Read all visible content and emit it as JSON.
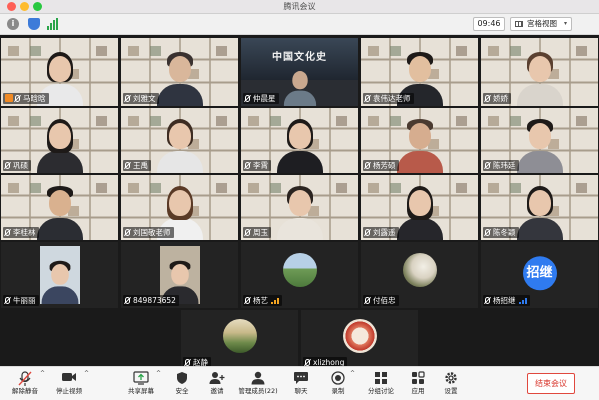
{
  "window": {
    "title": "腾讯会议"
  },
  "topbar": {
    "info_icon": "info-icon",
    "timer": "09:46",
    "view_label": "宫格视图"
  },
  "colors": {
    "active_speaker": "#2fd14b",
    "end_meeting": "#d8342a",
    "avatar_blue": "#2f7bf0"
  },
  "participants": [
    {
      "name": "马晗晗",
      "host": true,
      "muted": true
    },
    {
      "name": "刘雅文",
      "muted": true,
      "active": true
    },
    {
      "name": "仲晨星",
      "muted": true,
      "banner": "中国文化史"
    },
    {
      "name": "袁伟达老师",
      "muted": true
    },
    {
      "name": "娇娇",
      "muted": true
    },
    {
      "name": "巩硕",
      "muted": true
    },
    {
      "name": "王禹",
      "muted": true
    },
    {
      "name": "李霄",
      "muted": true
    },
    {
      "name": "杨芳硕",
      "muted": true
    },
    {
      "name": "陈玮廷",
      "muted": true
    },
    {
      "name": "李桂林",
      "muted": true
    },
    {
      "name": "刘国敬老师",
      "muted": true
    },
    {
      "name": "周玉",
      "muted": true
    },
    {
      "name": "刘露遥",
      "muted": true
    },
    {
      "name": "陈冬颖",
      "muted": true
    },
    {
      "name": "牛丽丽",
      "muted": true
    },
    {
      "name": "849873652",
      "muted": true
    },
    {
      "name": "杨艺",
      "muted": true,
      "signal": true
    },
    {
      "name": "付佰忠",
      "muted": true
    },
    {
      "name": "杨招继",
      "muted": true,
      "signal": true,
      "avatar_text": "招继"
    },
    {
      "name": "赵静",
      "muted": true
    },
    {
      "name": "xlizhong",
      "muted": true
    }
  ],
  "toolbar": {
    "unmute": "解除静音",
    "stop_video": "停止视频",
    "share_screen": "共享屏幕",
    "security": "安全",
    "invite": "邀请",
    "manage_members": "管理成员(22)",
    "chat": "聊天",
    "record": "录制",
    "breakout": "分组讨论",
    "apps": "应用",
    "settings": "设置",
    "end_meeting": "结束会议"
  }
}
